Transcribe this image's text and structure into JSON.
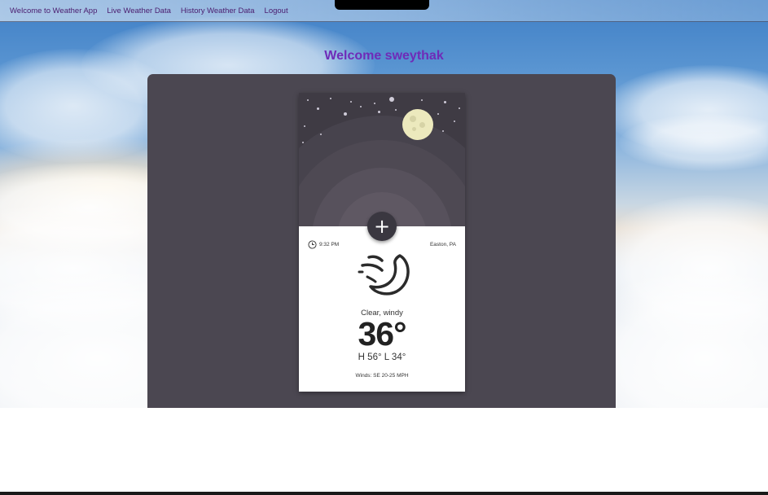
{
  "nav": {
    "links": [
      {
        "label": "Welcome to Weather App"
      },
      {
        "label": "Live Weather Data"
      },
      {
        "label": "History Weather Data"
      },
      {
        "label": "Logout"
      }
    ]
  },
  "welcome": "Welcome sweythak",
  "card": {
    "time": "9:32 PM",
    "location": "Easton, PA",
    "condition": "Clear, windy",
    "temperature": "36°",
    "hilo": "H 56°  L 34°",
    "winds": "Winds: SE 20-25 MPH",
    "add_label": "+",
    "icons": [
      "clock-icon",
      "moon-wind-icon",
      "plus-icon",
      "moon-illustration"
    ]
  },
  "colors": {
    "welcome_text": "#6f2bb8",
    "nav_text": "#4a1c6e",
    "panel": "#4b4751",
    "card_sky": "#3f3b44",
    "moon": "#ece9bd"
  }
}
